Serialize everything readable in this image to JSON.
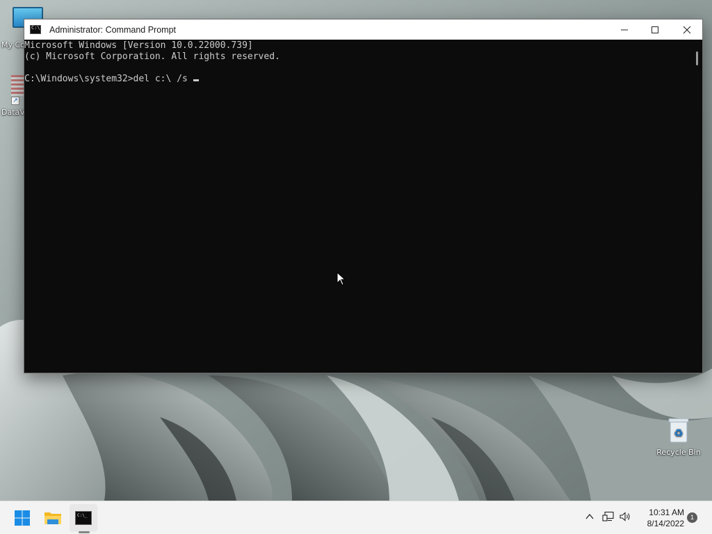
{
  "desktop": {
    "icons": [
      {
        "label": "My Co"
      },
      {
        "label": "DataV"
      },
      {
        "label": "Recycle Bin"
      }
    ]
  },
  "window": {
    "title": "Administrator: Command Prompt",
    "console_lines": [
      "Microsoft Windows [Version 10.0.22000.739]",
      "(c) Microsoft Corporation. All rights reserved.",
      "",
      "C:\\Windows\\system32>del c:\\ /s "
    ]
  },
  "taskbar": {
    "time": "10:31 AM",
    "date": "8/14/2022",
    "notification_count": "1"
  },
  "colors": {
    "console_bg": "#0c0c0c",
    "console_fg": "#cccccc",
    "taskbar_bg": "#f3f3f3",
    "accent": "#0078d4"
  }
}
